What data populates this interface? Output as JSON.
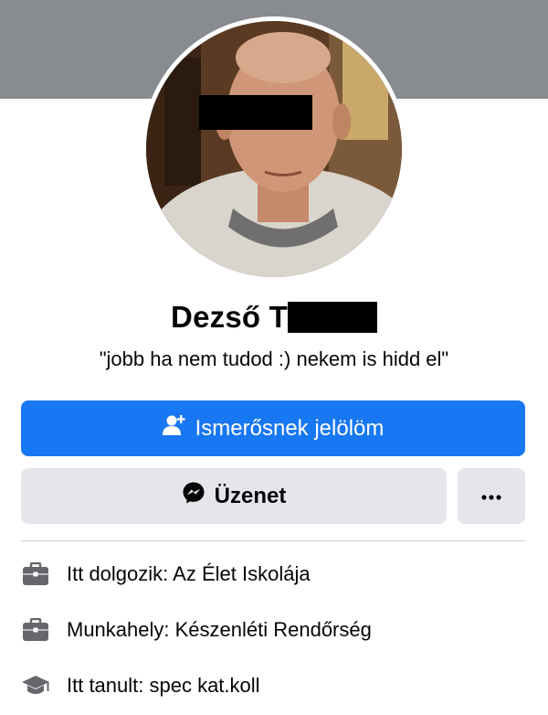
{
  "profile": {
    "name_visible": "Dezső T",
    "bio": "\"jobb ha nem tudod :) nekem is hidd el\""
  },
  "actions": {
    "add_friend_label": "Ismerősnek jelölöm",
    "message_label": "Üzenet",
    "more_label": "···"
  },
  "info": [
    {
      "icon": "briefcase-icon",
      "text": "Itt dolgozik: Az Élet Iskolája"
    },
    {
      "icon": "briefcase-icon",
      "text": "Munkahely: Készenléti Rendőrség"
    },
    {
      "icon": "graduation-cap-icon",
      "text": "Itt tanult: spec kat.koll"
    }
  ],
  "colors": {
    "primary": "#1877f2",
    "secondary_bg": "#e4e6eb",
    "cover": "#888c91"
  }
}
